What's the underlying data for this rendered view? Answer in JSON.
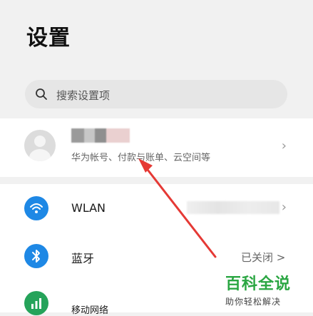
{
  "header": {
    "title": "设置"
  },
  "search": {
    "placeholder": "搜索设置项",
    "icon": "search-icon"
  },
  "account": {
    "subtitle": "华为帐号、付款与账单、云空间等",
    "avatar_icon": "avatar-placeholder-icon"
  },
  "settings": [
    {
      "id": "wlan",
      "label": "WLAN",
      "icon": "wifi-icon",
      "status": ""
    },
    {
      "id": "bluetooth",
      "label": "蓝牙",
      "icon": "bluetooth-icon",
      "status": "已关闭 >"
    },
    {
      "id": "mobile-network",
      "label": "移动网络",
      "icon": "mobile-network-icon",
      "status": ""
    }
  ],
  "watermark": {
    "main": "百科全说",
    "sub": "助你轻松解决"
  },
  "colors": {
    "accent": "#1e88e5",
    "annotation_arrow": "#e53935",
    "watermark": "#2aa642"
  }
}
